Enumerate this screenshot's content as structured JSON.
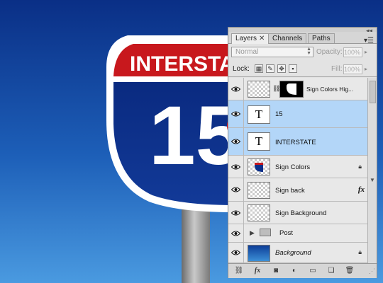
{
  "panel": {
    "tabs": [
      {
        "label": "Layers",
        "close": "✕",
        "active": true
      },
      {
        "label": "Channels",
        "active": false
      },
      {
        "label": "Paths",
        "active": false
      }
    ],
    "blend_mode": "Normal",
    "opacity_label": "Opacity:",
    "opacity_value": "100%",
    "lock_label": "Lock:",
    "fill_label": "Fill:",
    "fill_value": "100%",
    "layers": [
      {
        "name": "Sign Colors Hig...",
        "type": "mask",
        "selected": false,
        "icon": "lock-chain-icon"
      },
      {
        "name": "15",
        "type": "text",
        "thumb_text": "T",
        "selected": true
      },
      {
        "name": "INTERSTATE",
        "type": "text",
        "thumb_text": "T",
        "selected": true
      },
      {
        "name": "Sign Colors",
        "type": "shape",
        "selected": false,
        "icon": "lock-icon"
      },
      {
        "name": "Sign back",
        "type": "pixel",
        "selected": false,
        "fx": "fx"
      },
      {
        "name": "Sign Background",
        "type": "pixel",
        "selected": false
      },
      {
        "name": "Post",
        "type": "group",
        "selected": false
      },
      {
        "name": "Background",
        "type": "background",
        "selected": false,
        "icon": "lock-icon"
      }
    ],
    "bottom_tools": [
      "link-layers-icon",
      "fx-icon",
      "mask-icon",
      "adjustment-icon",
      "group-icon",
      "new-layer-icon",
      "trash-icon"
    ]
  },
  "canvas": {
    "sign_top_text": "INTERSTA",
    "sign_number": "15"
  },
  "colors": {
    "sky_top": "#0d3e98",
    "sky_bottom": "#3c8fd6",
    "sign_red": "#c8181d",
    "sign_blue": "#0b2f8a",
    "highlight_ellipse": "#e01010",
    "selection": "#b3d6f8"
  }
}
